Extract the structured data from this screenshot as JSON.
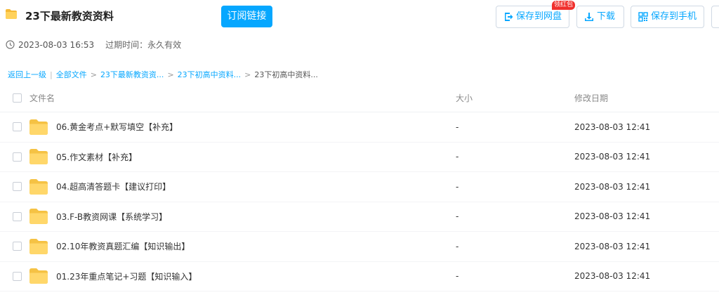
{
  "header": {
    "title": "23下最新教资资料",
    "subscribe_label": "订阅链接",
    "badge_label": "领红包",
    "save_label": "保存到网盘",
    "download_label": "下载",
    "save_phone_label": "保存到手机"
  },
  "meta": {
    "created": "2023-08-03 16:53",
    "expire": "过期时间：永久有效"
  },
  "breadcrumb": {
    "back": "返回上一级",
    "all_files": "全部文件",
    "level1": "23下最新教资资...",
    "level2": "23下初高中资料...",
    "current": "23下初高中资料..."
  },
  "table": {
    "headers": {
      "name": "文件名",
      "size": "大小",
      "date": "修改日期"
    },
    "rows": [
      {
        "name": "06.黄金考点+默写填空【补充】",
        "size": "-",
        "date": "2023-08-03 12:41"
      },
      {
        "name": "05.作文素材【补充】",
        "size": "-",
        "date": "2023-08-03 12:41"
      },
      {
        "name": "04.超高清答题卡【建议打印】",
        "size": "-",
        "date": "2023-08-03 12:41"
      },
      {
        "name": "03.F-B教资网课【系统学习】",
        "size": "-",
        "date": "2023-08-03 12:41"
      },
      {
        "name": "02.10年教资真题汇编【知识输出】",
        "size": "-",
        "date": "2023-08-03 12:41"
      },
      {
        "name": "01.23年重点笔记+习题【知识输入】",
        "size": "-",
        "date": "2023-08-03 12:41"
      }
    ]
  },
  "colors": {
    "accent": "#06a7ff",
    "folder": "#ffd25c",
    "badge": "#f0302d"
  }
}
